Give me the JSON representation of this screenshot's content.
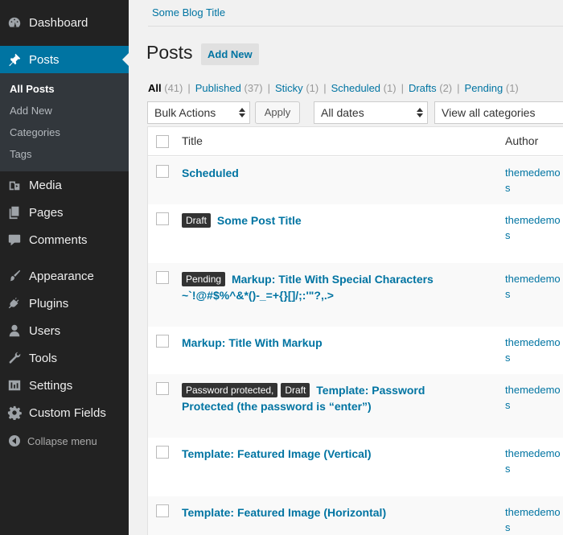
{
  "sidebar": {
    "dashboard": "Dashboard",
    "posts": "Posts",
    "submenu": [
      "All Posts",
      "Add New",
      "Categories",
      "Tags"
    ],
    "media": "Media",
    "pages": "Pages",
    "comments": "Comments",
    "appearance": "Appearance",
    "plugins": "Plugins",
    "users": "Users",
    "tools": "Tools",
    "settings": "Settings",
    "custom_fields": "Custom Fields",
    "collapse": "Collapse menu"
  },
  "header": {
    "blog_title": "Some Blog Title",
    "page_title": "Posts",
    "add_new": "Add New"
  },
  "filters": [
    {
      "label": "All",
      "count": "(41)"
    },
    {
      "label": "Published",
      "count": "(37)"
    },
    {
      "label": "Sticky",
      "count": "(1)"
    },
    {
      "label": "Scheduled",
      "count": "(1)"
    },
    {
      "label": "Drafts",
      "count": "(2)"
    },
    {
      "label": "Pending",
      "count": "(1)"
    }
  ],
  "actions": {
    "bulk": "Bulk Actions",
    "apply": "Apply",
    "dates": "All dates",
    "categories": "View all categories"
  },
  "table": {
    "col_title": "Title",
    "col_author": "Author",
    "rows": [
      {
        "badges": [],
        "title": "Scheduled",
        "author_1": "themedemo",
        "author_2": "s"
      },
      {
        "badges": [
          "Draft"
        ],
        "title": "Some Post Title",
        "author_1": "themedemo",
        "author_2": "s"
      },
      {
        "badges": [
          "Pending"
        ],
        "title": "Markup: Title With Special Characters ~`!@#$%^&*()-_=+{}[]/;:'\"?,.>",
        "author_1": "themedemo",
        "author_2": "s"
      },
      {
        "badges": [],
        "title": "Markup: Title With Markup",
        "author_1": "themedemo",
        "author_2": "s"
      },
      {
        "badges": [
          "Password protected,",
          "Draft"
        ],
        "title": "Template: Password Protected (the password is “enter”)",
        "author_1": "themedemo",
        "author_2": "s"
      },
      {
        "badges": [],
        "title": "Template: Featured Image (Vertical)",
        "author_1": "themedemo",
        "author_2": "s"
      },
      {
        "badges": [],
        "title": "Template: Featured Image (Horizontal)",
        "author_1": "themedemo",
        "author_2": "s"
      }
    ]
  }
}
